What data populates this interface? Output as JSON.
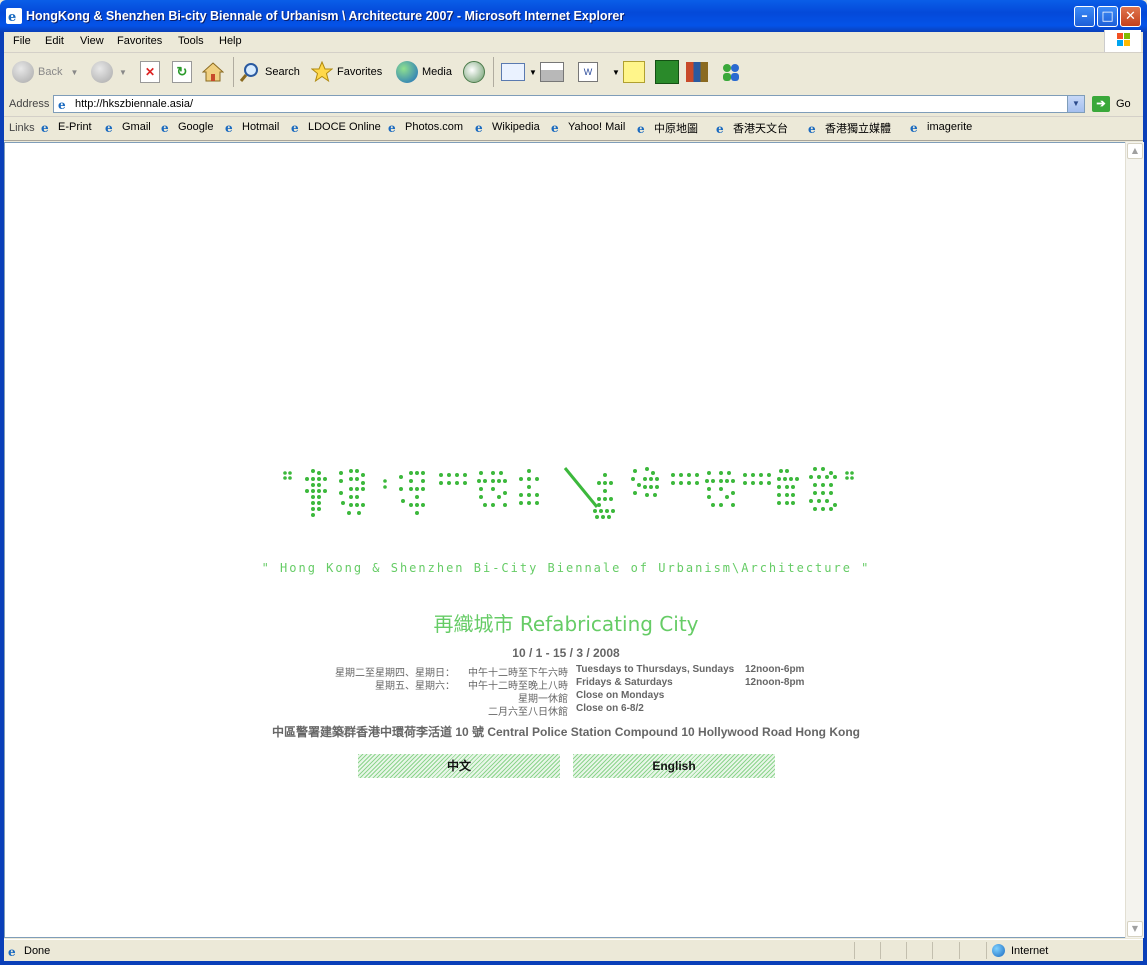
{
  "window": {
    "title": "HongKong & Shenzhen Bi-city Biennale of Urbanism \\ Architecture 2007 - Microsoft Internet Explorer"
  },
  "menu": [
    "File",
    "Edit",
    "View",
    "Favorites",
    "Tools",
    "Help"
  ],
  "toolbar": {
    "back_label": "Back",
    "search_label": "Search",
    "favorites_label": "Favorites",
    "media_label": "Media"
  },
  "address": {
    "label": "Address",
    "url": "http://hkszbiennale.asia/",
    "go_label": "Go"
  },
  "links": {
    "label": "Links",
    "items": [
      "E-Print",
      "Gmail",
      "Google",
      "Hotmail",
      "LDOCE Online",
      "Photos.com",
      "Wikipedia",
      "Yahoo! Mail",
      "中原地圖",
      "香港天文台",
      "香港獨立媒體",
      "imagerite"
    ]
  },
  "page": {
    "subtitle": "\" Hong Kong & Shenzhen Bi-City Biennale of Urbanism\\Architecture \"",
    "theme": "再織城市 Refabricating City",
    "dates": "10 / 1 -  15 / 3 / 2008",
    "hours": [
      {
        "days_zh": "星期二至星期四、星期日：",
        "time_zh": "中午十二時至下午六時",
        "days_en": "Tuesdays to Thursdays, Sundays",
        "time_en": "12noon-6pm"
      },
      {
        "days_zh": "星期五、星期六：",
        "time_zh": "中午十二時至晚上八時",
        "days_en": "Fridays & Saturdays",
        "time_en": "12noon-8pm"
      },
      {
        "days_zh": "",
        "time_zh": "星期一休館",
        "days_en": "Close on Mondays",
        "time_en": ""
      },
      {
        "days_zh": "",
        "time_zh": "二月六至八日休館",
        "days_en": "Close on 6-8/2",
        "time_en": ""
      }
    ],
    "venue": "中區警署建築群香港中環荷李活道 10 號 Central Police Station Compound 10 Hollywood Road Hong Kong",
    "lang_buttons": {
      "chinese": "中文",
      "english": "English"
    },
    "accent_color": "#66CC66"
  },
  "status": {
    "text": "Done",
    "zone": "Internet"
  }
}
